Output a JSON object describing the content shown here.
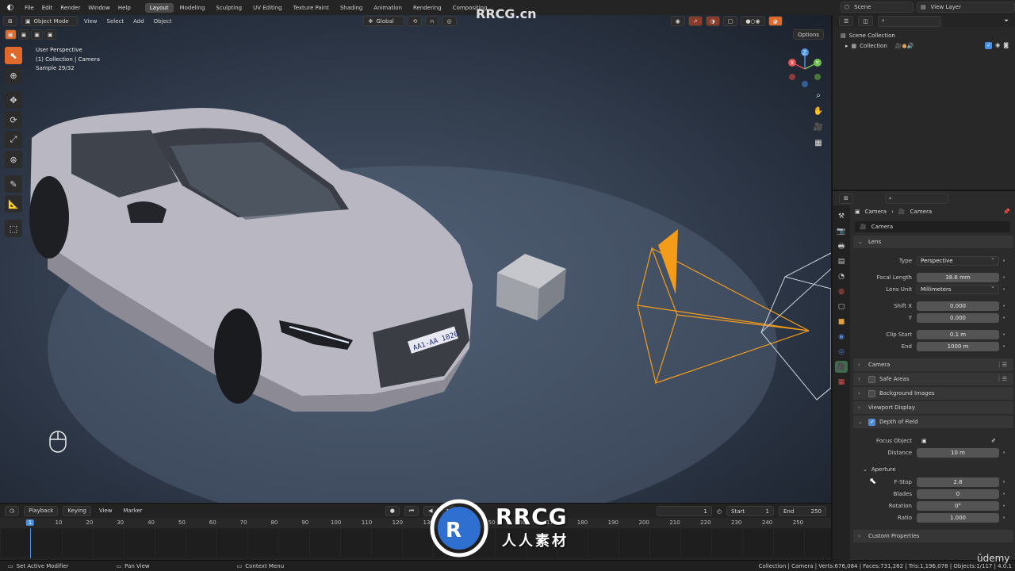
{
  "menubar": {
    "menus": [
      "File",
      "Edit",
      "Render",
      "Window",
      "Help"
    ],
    "workspaces": [
      "Layout",
      "Modeling",
      "Sculpting",
      "UV Editing",
      "Texture Paint",
      "Shading",
      "Animation",
      "Rendering",
      "Compositing"
    ],
    "active_workspace": "Layout",
    "scene": "Scene",
    "view_layer": "View Layer"
  },
  "viewport": {
    "mode": "Object Mode",
    "menus": [
      "View",
      "Select",
      "Add",
      "Object"
    ],
    "transform_orientation": "Global",
    "options_label": "Options",
    "info_line1": "User Perspective",
    "info_line2": "(1) Collection | Camera",
    "info_line3": "Sample 29/32",
    "gizmo_axes": [
      "X",
      "Y",
      "Z"
    ],
    "license_plate": "AA1-AA 1020",
    "colors": {
      "camera_selected": "#f39c1a",
      "camera_other": "#c9d3dd",
      "car_body": "#b9b8c2",
      "accent": "#e06a2b"
    }
  },
  "timeline": {
    "menus": [
      "Playback",
      "Keying",
      "View",
      "Marker"
    ],
    "current_frame": "1",
    "start_label": "Start",
    "start": "1",
    "end_label": "End",
    "end": "250",
    "ticks": [
      "1",
      "10",
      "20",
      "30",
      "40",
      "50",
      "60",
      "70",
      "80",
      "90",
      "100",
      "110",
      "120",
      "130",
      "140",
      "150",
      "160",
      "170",
      "180",
      "190",
      "200",
      "210",
      "220",
      "230",
      "240",
      "250"
    ]
  },
  "statusbar": {
    "left": "Set Active Modifier",
    "middle": "Pan View",
    "right": "Context Menu",
    "stats": "Collection | Camera | Verts:676,084 | Faces:731,282 | Tris:1,196,078 | Objects:1/117 | 4.0.1"
  },
  "outliner": {
    "root": "Scene Collection",
    "collection": "Collection"
  },
  "properties": {
    "breadcrumb_object": "Camera",
    "breadcrumb_data": "Camera",
    "datablock": "Camera",
    "lens_panel": "Lens",
    "type_label": "Type",
    "type_value": "Perspective",
    "focal_label": "Focal Length",
    "focal_value": "38.6 mm",
    "lens_unit_label": "Lens Unit",
    "lens_unit_value": "Millimeters",
    "shift_x_label": "Shift X",
    "shift_x_value": "0.000",
    "shift_y_label": "Y",
    "shift_y_value": "0.000",
    "clip_start_label": "Clip Start",
    "clip_start_value": "0.1 m",
    "clip_end_label": "End",
    "clip_end_value": "1000 m",
    "camera_panel": "Camera",
    "safe_areas_panel": "Safe Areas",
    "bg_images_panel": "Background Images",
    "viewport_display_panel": "Viewport Display",
    "dof_panel": "Depth of Field",
    "focus_object_label": "Focus Object",
    "distance_label": "Distance",
    "distance_value": "10 m",
    "aperture_label": "Aperture",
    "fstop_label": "F-Stop",
    "fstop_value": "2.8",
    "blades_label": "Blades",
    "blades_value": "0",
    "rotation_label": "Rotation",
    "rotation_value": "0°",
    "ratio_label": "Ratio",
    "ratio_value": "1.000",
    "custom_props_panel": "Custom Properties"
  },
  "watermarks": {
    "top": "RRCG.cn",
    "logo_text": "RRCG",
    "logo_cn": "人人素材",
    "udemy": "ūdemy"
  }
}
